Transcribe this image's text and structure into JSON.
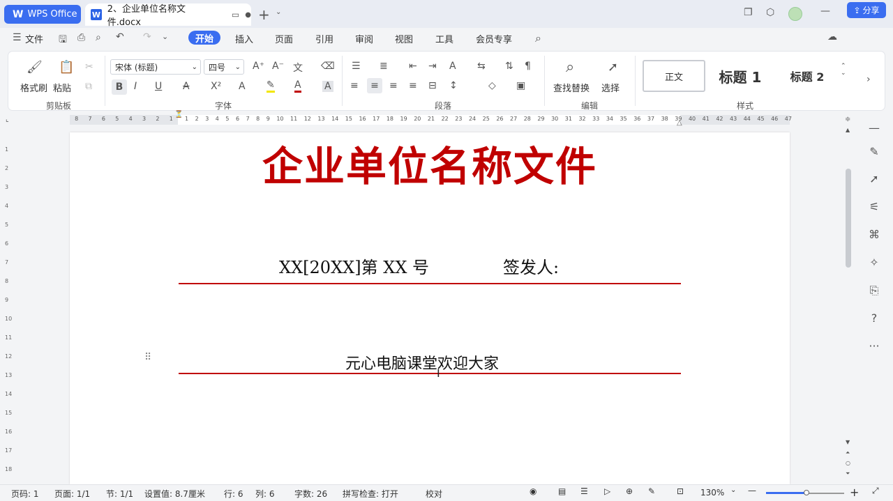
{
  "titlebar": {
    "app_label": "WPS Office",
    "tab_title": "2、企业单位名称文件.docx"
  },
  "menu": {
    "file": "文件",
    "tabs": [
      "开始",
      "插入",
      "页面",
      "引用",
      "审阅",
      "视图",
      "工具",
      "会员专享"
    ],
    "active_tab": "开始",
    "share": "分享"
  },
  "ribbon": {
    "format_painter": "格式刷",
    "paste": "粘贴",
    "font_name": "宋体 (标题)",
    "font_size": "四号",
    "find_replace": "查找替换",
    "select": "选择",
    "style_normal": "正文",
    "style_h1": "标题 1",
    "style_h2": "标题 2",
    "groups": {
      "clipboard": "剪贴板",
      "font": "字体",
      "paragraph": "段落",
      "edit": "编辑",
      "styles": "样式"
    }
  },
  "ruler": {
    "top_left": [
      "8",
      "7",
      "6",
      "5",
      "4",
      "3",
      "2",
      "1"
    ],
    "top_right": [
      "1",
      "2",
      "3",
      "4",
      "5",
      "6",
      "7",
      "8",
      "9",
      "10",
      "11",
      "12",
      "13",
      "14",
      "15",
      "16",
      "17",
      "18",
      "19",
      "20",
      "21",
      "22",
      "23",
      "24",
      "25",
      "26",
      "27",
      "28",
      "29",
      "30",
      "31",
      "32",
      "33",
      "34",
      "35",
      "36",
      "37",
      "38",
      "39",
      "40",
      "41",
      "42",
      "43",
      "44",
      "45",
      "46",
      "47"
    ],
    "left": [
      "1",
      "2",
      "3",
      "4",
      "5",
      "6",
      "7",
      "8",
      "9",
      "10",
      "11",
      "12",
      "13",
      "14",
      "15",
      "16",
      "17",
      "18"
    ]
  },
  "document": {
    "title": "企业单位名称文件",
    "number": "XX[20XX]第 XX 号",
    "signer": "签发人:",
    "welcome": "元心电脑课堂欢迎大家"
  },
  "status": {
    "page_num": "页码: 1",
    "pages": "页面: 1/1",
    "section": "节: 1/1",
    "setting": "设置值: 8.7厘米",
    "row": "行: 6",
    "col": "列: 6",
    "words": "字数: 26",
    "spellcheck": "拼写检查: 打开",
    "proof": "校对",
    "zoom": "130%",
    "zoom_level_percent": 52
  },
  "colors": {
    "accent": "#3a6df0",
    "title_red": "#c00000"
  }
}
